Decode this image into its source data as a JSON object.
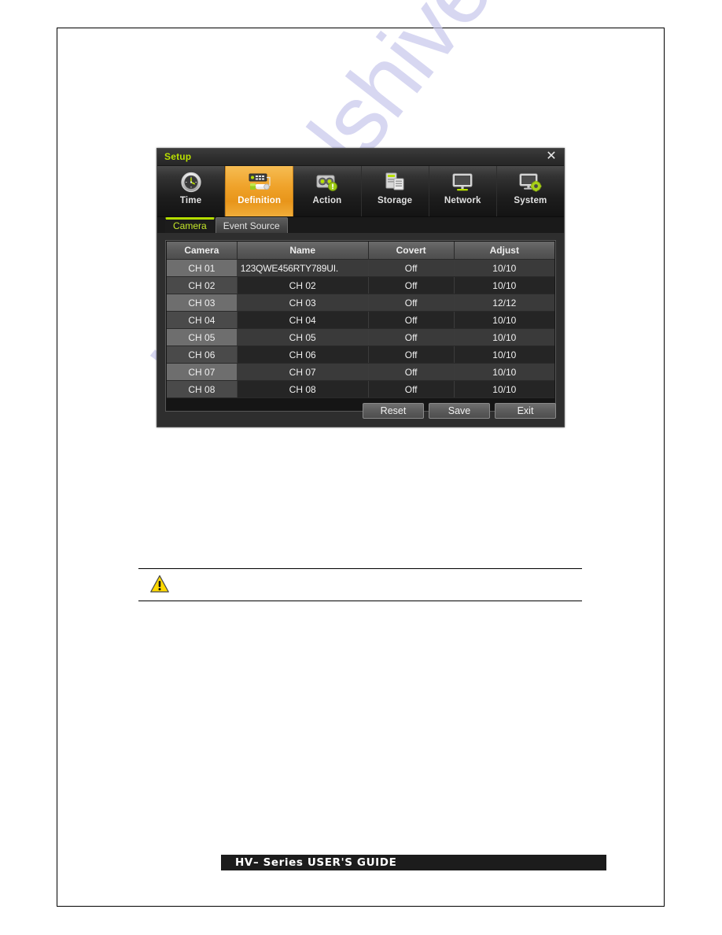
{
  "document": {
    "watermark_text": "manualshive",
    "footer_banner_text": "HV– Series USER'S GUIDE",
    "note_text": ""
  },
  "dialog": {
    "title": "Setup",
    "close_icon": "close-icon",
    "toolbar": {
      "items": [
        {
          "label": "Time",
          "icon": "clock-icon",
          "active": false
        },
        {
          "label": "Definition",
          "icon": "camera-definition-icon",
          "active": true
        },
        {
          "label": "Action",
          "icon": "action-alert-icon",
          "active": false
        },
        {
          "label": "Storage",
          "icon": "storage-disk-icon",
          "active": false
        },
        {
          "label": "Network",
          "icon": "monitor-network-icon",
          "active": false
        },
        {
          "label": "System",
          "icon": "monitor-gear-icon",
          "active": false
        }
      ]
    },
    "subtabs": [
      {
        "label": "Camera",
        "active": true
      },
      {
        "label": "Event Source",
        "active": false
      }
    ],
    "table": {
      "columns": [
        "Camera",
        "Name",
        "Covert",
        "Adjust"
      ],
      "rows": [
        {
          "camera": "CH 01",
          "name": "123QWE456RTY789UI.",
          "covert": "Off",
          "adjust": "10/10",
          "long_name": true
        },
        {
          "camera": "CH 02",
          "name": "CH 02",
          "covert": "Off",
          "adjust": "10/10",
          "long_name": false
        },
        {
          "camera": "CH 03",
          "name": "CH 03",
          "covert": "Off",
          "adjust": "12/12",
          "long_name": false
        },
        {
          "camera": "CH 04",
          "name": "CH 04",
          "covert": "Off",
          "adjust": "10/10",
          "long_name": false
        },
        {
          "camera": "CH 05",
          "name": "CH 05",
          "covert": "Off",
          "adjust": "10/10",
          "long_name": false
        },
        {
          "camera": "CH 06",
          "name": "CH 06",
          "covert": "Off",
          "adjust": "10/10",
          "long_name": false
        },
        {
          "camera": "CH 07",
          "name": "CH 07",
          "covert": "Off",
          "adjust": "10/10",
          "long_name": false
        },
        {
          "camera": "CH 08",
          "name": "CH 08",
          "covert": "Off",
          "adjust": "10/10",
          "long_name": false
        }
      ]
    },
    "buttons": [
      {
        "label": "Reset"
      },
      {
        "label": "Save"
      },
      {
        "label": "Exit"
      }
    ]
  },
  "colors": {
    "accent_yellow_green": "#b9e000",
    "active_tab_orange": "#efa229",
    "dialog_bg": "#2e2e2e",
    "grid_bg": "#151515",
    "watermark": "#c9c9ec"
  }
}
